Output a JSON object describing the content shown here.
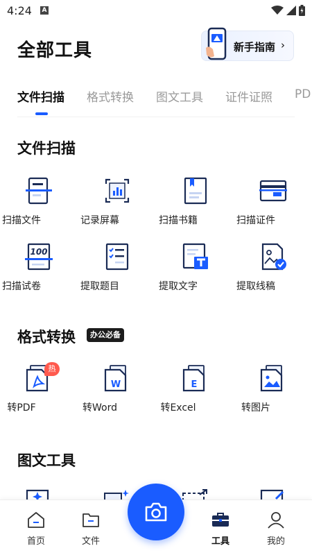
{
  "status": {
    "time": "4:24",
    "notification": "A"
  },
  "header": {
    "title": "全部工具",
    "guide_label": "新手指南",
    "guide_chevron": "›"
  },
  "tabs": [
    {
      "label": "文件扫描",
      "active": true
    },
    {
      "label": "格式转换",
      "active": false
    },
    {
      "label": "图文工具",
      "active": false
    },
    {
      "label": "证件证照",
      "active": false
    },
    {
      "label": "PDF",
      "active": false
    }
  ],
  "sections": {
    "scan": {
      "title": "文件扫描",
      "tools": [
        {
          "label": "扫描文件",
          "icon": "scan-document-icon"
        },
        {
          "label": "记录屏幕",
          "icon": "record-screen-icon"
        },
        {
          "label": "扫描书籍",
          "icon": "scan-book-icon"
        },
        {
          "label": "扫描证件",
          "icon": "scan-id-card-icon"
        },
        {
          "label": "扫描试卷",
          "icon": "scan-exam-icon"
        },
        {
          "label": "提取题目",
          "icon": "extract-questions-icon"
        },
        {
          "label": "提取文字",
          "icon": "extract-text-icon"
        },
        {
          "label": "提取线稿",
          "icon": "extract-lineart-icon"
        }
      ]
    },
    "convert": {
      "title": "格式转换",
      "badge": "办公必备",
      "hot_badge": "热",
      "tools": [
        {
          "label": "转PDF",
          "icon": "to-pdf-icon"
        },
        {
          "label": "转Word",
          "icon": "to-word-icon"
        },
        {
          "label": "转Excel",
          "icon": "to-excel-icon"
        },
        {
          "label": "转图片",
          "icon": "to-image-icon"
        }
      ]
    },
    "image_text": {
      "title": "图文工具"
    }
  },
  "bottom_nav": [
    {
      "label": "首页",
      "icon": "home-icon"
    },
    {
      "label": "文件",
      "icon": "folder-icon"
    },
    {
      "label": "工具",
      "icon": "toolbox-icon",
      "active": true
    },
    {
      "label": "我的",
      "icon": "profile-icon"
    }
  ],
  "colors": {
    "accent": "#1a5cff",
    "hot": "#ff5a4e",
    "badge_bg": "#1c1c1c"
  }
}
